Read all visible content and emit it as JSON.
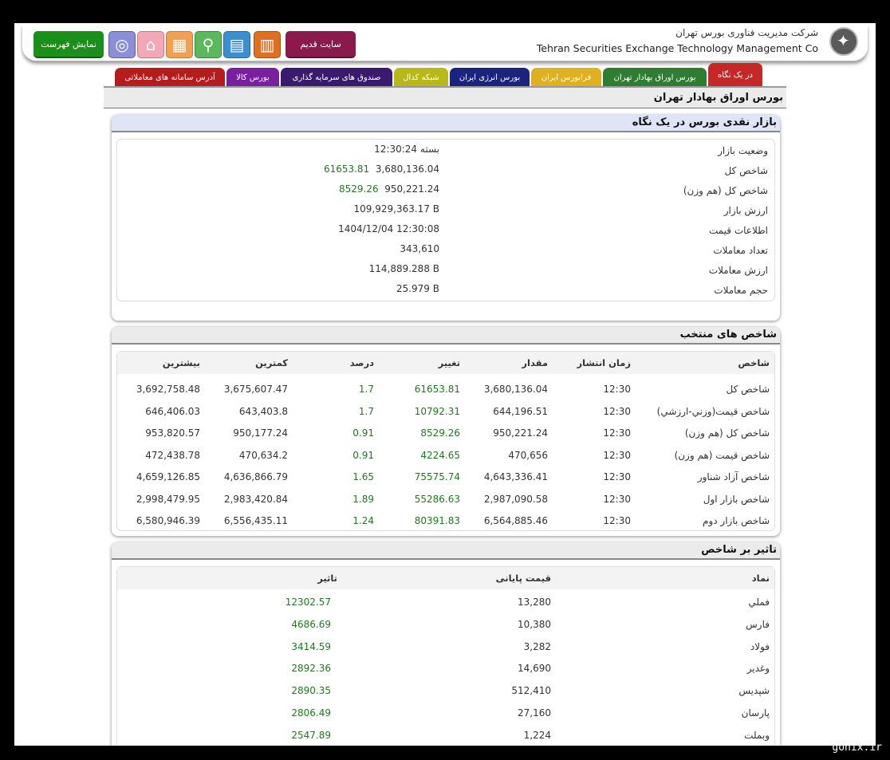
{
  "header": {
    "company_fa": "شرکت مدیریت فناوری بورس تهران",
    "company_en": "Tehran Securities Exchange Technology Management Co",
    "show_menu_label": "نمایش فهرست",
    "old_site_label": "سایت قدیم",
    "icons": [
      "globe-icon",
      "home-icon",
      "calculator-icon",
      "search-icon",
      "book-icon",
      "grid-icon"
    ]
  },
  "tabs": [
    {
      "label": "در یک نگاه",
      "color": "#c62828"
    },
    {
      "label": "بورس اوراق بهادار تهران",
      "color": "#2e7d32"
    },
    {
      "label": "فرابورس ایران",
      "color": "#e0b020"
    },
    {
      "label": "بورس انرژی ایران",
      "color": "#1a237e"
    },
    {
      "label": "شبکه کدال",
      "color": "#b8b81a"
    },
    {
      "label": "صندوق های سرمایه گذاری",
      "color": "#3a1a6e"
    },
    {
      "label": "بورس کالا",
      "color": "#7b1fa2"
    },
    {
      "label": "آدرس سامانه های معاملاتی",
      "color": "#b71c1c"
    }
  ],
  "page_title": "بورس اوراق بهادار تهران",
  "market_glance": {
    "title": "بازار نقدی بورس در یک نگاه",
    "rows": [
      {
        "label": "وضعیت بازار",
        "value": "بسته 12:30:24",
        "change": ""
      },
      {
        "label": "شاخص کل",
        "value": "3,680,136.04",
        "change": "61653.81"
      },
      {
        "label": "شاخص کل (هم وزن)",
        "value": "950,221.24",
        "change": "8529.26"
      },
      {
        "label": "ارزش بازار",
        "value": "109,929,363.17 B",
        "change": ""
      },
      {
        "label": "اطلاعات قیمت",
        "value": "1404/12/04 12:30:08",
        "change": ""
      },
      {
        "label": "تعداد معاملات",
        "value": "343,610",
        "change": ""
      },
      {
        "label": "ارزش معاملات",
        "value": "114,889.288 B",
        "change": ""
      },
      {
        "label": "حجم معاملات",
        "value": "25.979 B",
        "change": ""
      }
    ]
  },
  "selected_indices": {
    "title": "شاخص های منتخب",
    "columns": [
      "شاخص",
      "زمان انتشار",
      "مقدار",
      "تغییر",
      "درصد",
      "کمترین",
      "بیشترین"
    ],
    "rows": [
      [
        "شاخص کل",
        "12:30",
        "3,680,136.04",
        "61653.81",
        "1.7",
        "3,675,607.47",
        "3,692,758.48"
      ],
      [
        "شاخص قیمت(وزني-ارزشي)",
        "12:30",
        "644,196.51",
        "10792.31",
        "1.7",
        "643,403.8",
        "646,406.03"
      ],
      [
        "شاخص کل (هم وزن)",
        "12:30",
        "950,221.24",
        "8529.26",
        "0.91",
        "950,177.24",
        "953,820.57"
      ],
      [
        "شاخص قیمت (هم وزن)",
        "12:30",
        "470,656",
        "4224.65",
        "0.91",
        "470,634.2",
        "472,438.78"
      ],
      [
        "شاخص آزاد شناور",
        "12:30",
        "4,643,336.41",
        "75575.74",
        "1.65",
        "4,636,866.79",
        "4,659,126.85"
      ],
      [
        "شاخص بازار اول",
        "12:30",
        "2,987,090.58",
        "55286.63",
        "1.89",
        "2,983,420.84",
        "2,998,479.95"
      ],
      [
        "شاخص بازار دوم",
        "12:30",
        "6,564,885.46",
        "80391.83",
        "1.24",
        "6,556,435.11",
        "6,580,946.39"
      ]
    ]
  },
  "index_impact": {
    "title": "تاثیر بر شاخص",
    "columns": [
      "نماد",
      "قیمت پایانی",
      "تاثیر"
    ],
    "rows": [
      [
        "فملي",
        "13,280",
        "12302.57"
      ],
      [
        "فارس",
        "10,380",
        "4686.69"
      ],
      [
        "فولاد",
        "3,282",
        "3414.59"
      ],
      [
        "وغدير",
        "14,690",
        "2892.36"
      ],
      [
        "شپديس",
        "512,410",
        "2890.35"
      ],
      [
        "پارسان",
        "27,160",
        "2806.49"
      ],
      [
        "وبملت",
        "1,224",
        "2547.89"
      ]
    ]
  },
  "watermark": "gonix.ir"
}
